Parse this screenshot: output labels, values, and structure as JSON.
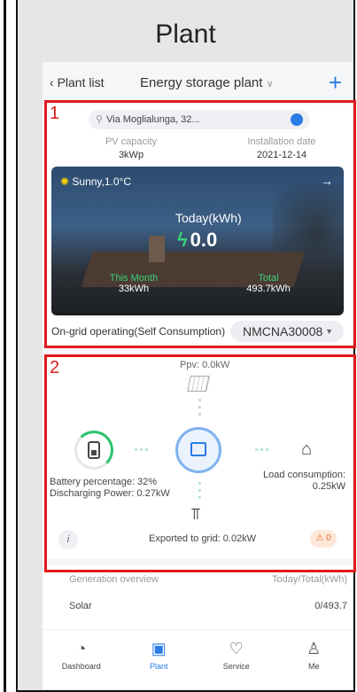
{
  "panel": {
    "title": "Plant"
  },
  "topbar": {
    "back_label": "Plant list",
    "plant_name": "Energy storage plant",
    "add_symbol": "+"
  },
  "plant_card": {
    "address": "Via Moglialunga, 32...",
    "pv_capacity_label": "PV capacity",
    "pv_capacity_value": "3kWp",
    "install_date_label": "Installation date",
    "install_date_value": "2021-12-14",
    "weather": "Sunny,1.0°C",
    "today_label": "Today(kWh)",
    "today_value": "0.0",
    "this_month_label": "This Month",
    "this_month_value": "33kWh",
    "total_label": "Total",
    "total_value": "493.7kWh",
    "status": "On-grid operating(Self Consumption)",
    "device_sn": "NMCNA30008"
  },
  "flow_card": {
    "ppv": "Ppv: 0.0kW",
    "battery_percentage": "Battery percentage: 32%",
    "discharging_power": "Discharging Power: 0.27kW",
    "load_consumption_label": "Load consumption:",
    "load_consumption_value": "0.25kW",
    "exported": "Exported to grid: 0.02kW",
    "alarm_count": "0",
    "info_symbol": "i"
  },
  "generation": {
    "title": "Generation overview",
    "units": "Today/Total(kWh)",
    "row_label": "Solar",
    "row_value": "0/493.7"
  },
  "tabs": [
    {
      "label": "Dashboard",
      "icon": "dashboard-icon"
    },
    {
      "label": "Plant",
      "icon": "plant-icon"
    },
    {
      "label": "Service",
      "icon": "service-icon"
    },
    {
      "label": "Me",
      "icon": "me-icon"
    }
  ],
  "annotations": {
    "box1_label": "1",
    "box2_label": "2"
  },
  "colors": {
    "accent": "#2a7be4",
    "annotation_red": "#e11b1b",
    "green": "#29c46c"
  }
}
